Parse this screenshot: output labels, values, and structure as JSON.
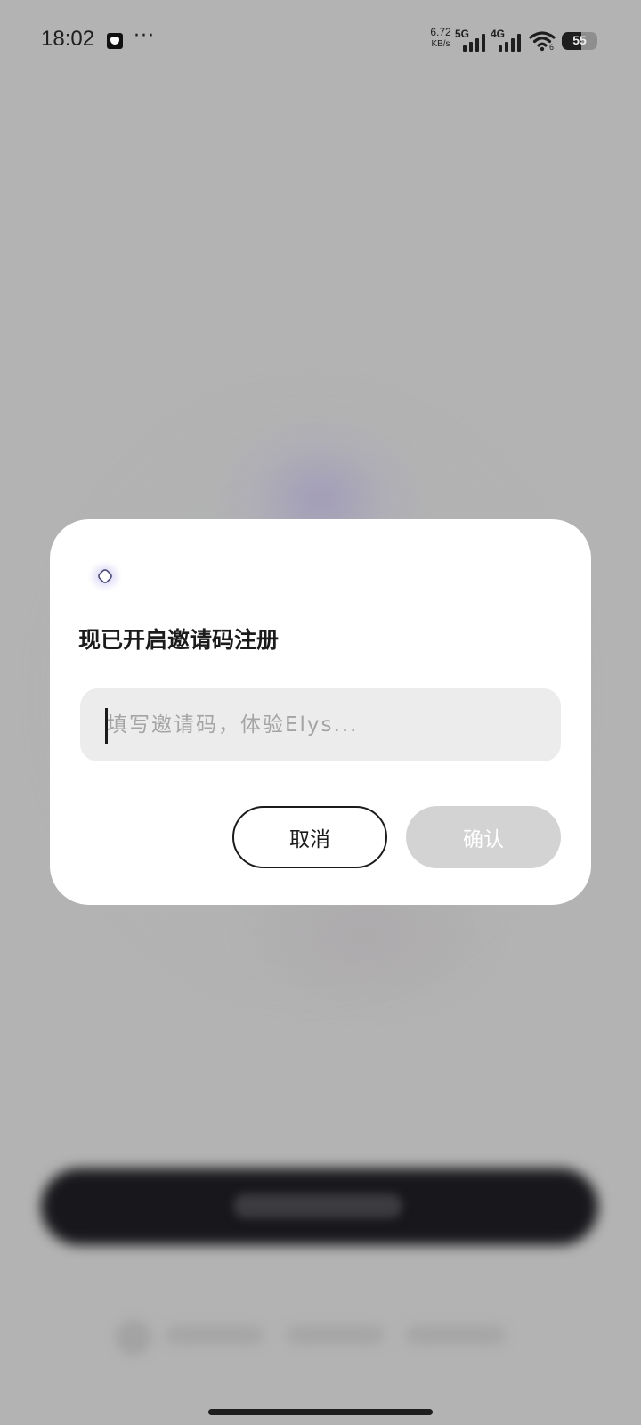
{
  "status_bar": {
    "time": "18:02",
    "more": "···",
    "net_speed_value": "6.72",
    "net_speed_unit": "KB/s",
    "network_1": "5G",
    "network_2": "4G",
    "wifi_label": "6",
    "battery_percent": "55",
    "battery_level": 0.55
  },
  "dialog": {
    "title": "现已开启邀请码注册",
    "input_placeholder": "填写邀请码，体验Elys...",
    "input_value": "",
    "cancel_label": "取消",
    "confirm_label": "确认"
  },
  "icons": {
    "app_notification": "app-notification-icon",
    "more": "more-icon",
    "signal": "signal-icon",
    "wifi": "wifi-icon",
    "battery": "battery-icon",
    "app_logo": "app-logo-icon"
  },
  "colors": {
    "overlay_background": "#b3b3b3",
    "dialog_background": "#ffffff",
    "input_background": "#ececec",
    "confirm_disabled": "#d3d3d3",
    "text_primary": "#1b1b1b",
    "placeholder": "#a4a4a4"
  }
}
